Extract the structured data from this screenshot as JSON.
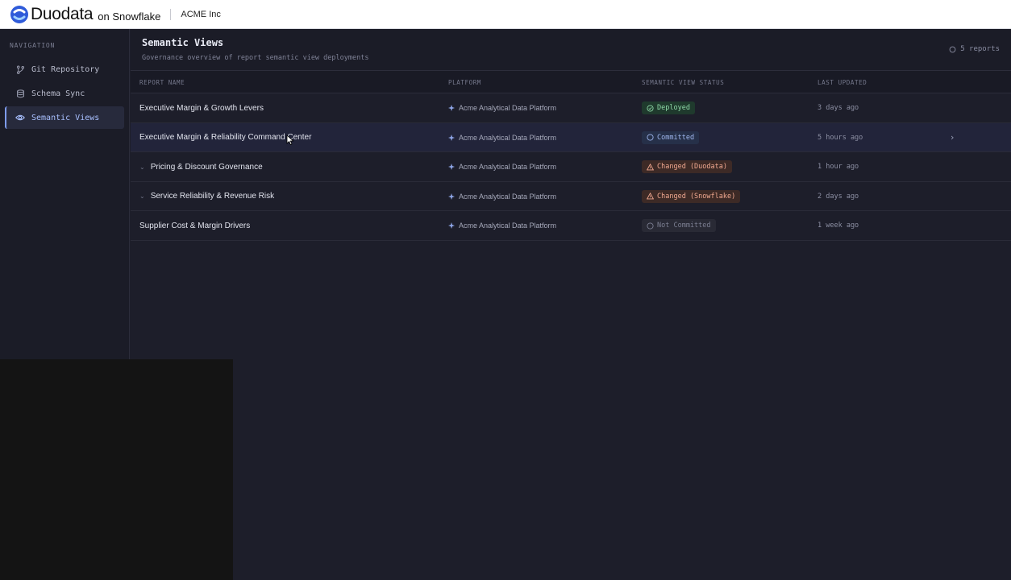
{
  "topbar": {
    "brand": "Duodata",
    "brand_suffix": "on Snowflake",
    "org": "ACME Inc",
    "logo_icon": "duodata-logo-icon",
    "brand_color": "#2f5bd9"
  },
  "sidebar": {
    "heading": "NAVIGATION",
    "items": [
      {
        "label": "Git Repository",
        "icon": "git-branch-icon",
        "active": false
      },
      {
        "label": "Schema Sync",
        "icon": "database-icon",
        "active": false
      },
      {
        "label": "Semantic Views",
        "icon": "eye-icon",
        "active": true
      }
    ]
  },
  "page": {
    "title": "Semantic Views",
    "subtitle": "Governance overview of report semantic view deployments",
    "count": "5 reports",
    "count_icon": "circle-icon"
  },
  "table": {
    "columns": [
      "REPORT NAME",
      "PLATFORM",
      "SEMANTIC VIEW STATUS",
      "LAST UPDATED"
    ],
    "rows": [
      {
        "name": "Executive Margin & Growth Levers",
        "expandable": false,
        "platform": "Acme Analytical Data Platform",
        "status": "Deployed",
        "status_kind": "deployed",
        "updated": "3 days ago"
      },
      {
        "name": "Executive Margin & Reliability Command Center",
        "expandable": false,
        "platform": "Acme Analytical Data Platform",
        "status": "Committed",
        "status_kind": "committed",
        "updated": "5 hours ago",
        "hovered": true
      },
      {
        "name": "Pricing & Discount Governance",
        "expandable": true,
        "platform": "Acme Analytical Data Platform",
        "status": "Changed (Duodata)",
        "status_kind": "changed",
        "updated": "1 hour ago"
      },
      {
        "name": "Service Reliability & Revenue Risk",
        "expandable": true,
        "platform": "Acme Analytical Data Platform",
        "status": "Changed (Snowflake)",
        "status_kind": "changed",
        "updated": "2 days ago"
      },
      {
        "name": "Supplier Cost & Margin Drivers",
        "expandable": false,
        "platform": "Acme Analytical Data Platform",
        "status": "Not Committed",
        "status_kind": "not-committed",
        "updated": "1 week ago"
      }
    ]
  },
  "colors": {
    "deployed_bg": "#1f3a2d",
    "deployed_fg": "#8fd9a8",
    "committed_bg": "#263049",
    "committed_fg": "#9fb6ee",
    "changed_bg": "#3d2a26",
    "changed_fg": "#f0a890",
    "not_committed_bg": "#292a35",
    "not_committed_fg": "#7c7f92",
    "accent": "#7e9cf0"
  }
}
